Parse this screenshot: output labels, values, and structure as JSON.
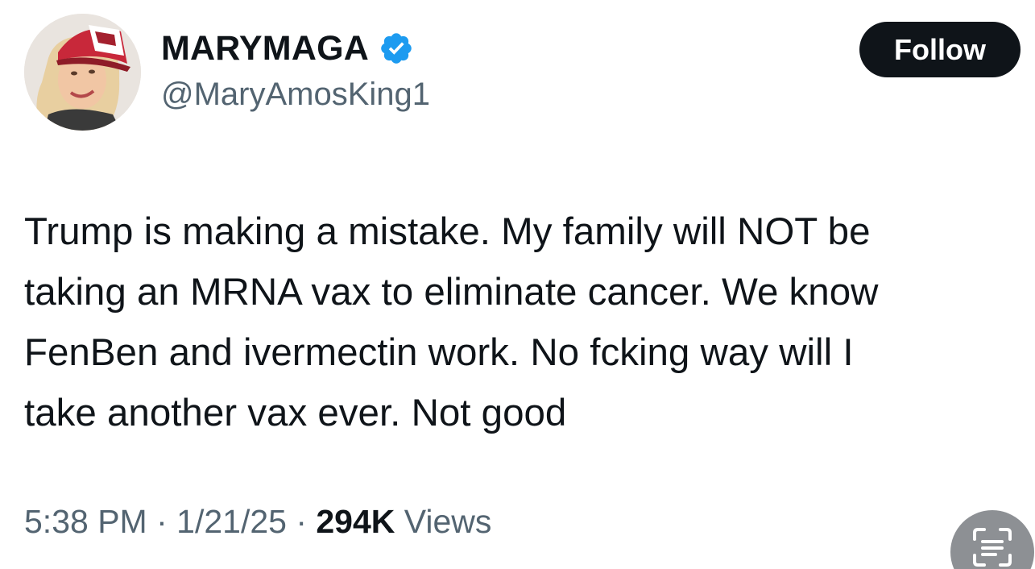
{
  "user": {
    "display_name": "MARYMAGA",
    "handle": "@MaryAmosKing1",
    "verified": true,
    "avatar_icon": "profile-photo-woman-red-cap"
  },
  "actions": {
    "follow_label": "Follow"
  },
  "tweet": {
    "text": "Trump is making a mistake. My family will NOT be\ntaking an MRNA vax to eliminate cancer. We know\nFenBen and ivermectin work. No fcking way will I\ntake another vax ever. Not good"
  },
  "meta": {
    "time": "5:38 PM",
    "separator": " · ",
    "date": "1/21/25",
    "views_count": "294K",
    "views_label": " Views"
  },
  "overlay": {
    "icon": "scan-text-icon"
  },
  "colors": {
    "text": "#0f1419",
    "secondary": "#536471",
    "verified": "#1d9bf0",
    "follow_bg": "#0f1419"
  }
}
